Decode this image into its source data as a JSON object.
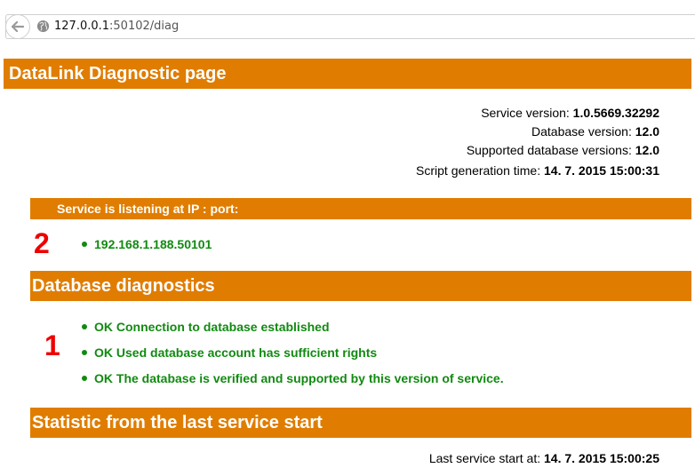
{
  "browser": {
    "url_host": "127.0.0.1",
    "url_rest": ":50102/diag"
  },
  "page_title": "DataLink Diagnostic page",
  "info": [
    {
      "label": "Service version:",
      "value": "1.0.5669.32292"
    },
    {
      "label": "Database version:",
      "value": "12.0"
    },
    {
      "label": "Supported database versions:",
      "value": "12.0"
    },
    {
      "label": "Script generation time:",
      "value": "14. 7. 2015 15:00:31"
    }
  ],
  "listening": {
    "heading": "Service is listening at IP : port:",
    "marker": "2",
    "items": [
      "192.168.1.188.50101"
    ]
  },
  "db_diagnostics": {
    "heading": "Database diagnostics",
    "marker": "1",
    "items": [
      "OK Connection to database established",
      "OK Used database account has sufficient rights",
      "OK The database is verified and supported by this version of service."
    ]
  },
  "statistic": {
    "heading": "Statistic from the last service start",
    "last_start_label": "Last service start at:",
    "last_start_value": "14. 7. 2015 15:00:25"
  },
  "colors": {
    "banner": "#e07d00",
    "ok_text": "#118a11",
    "marker": "#ee0000"
  },
  "icons": {
    "back": "back-arrow-icon",
    "site": "globe-icon"
  }
}
